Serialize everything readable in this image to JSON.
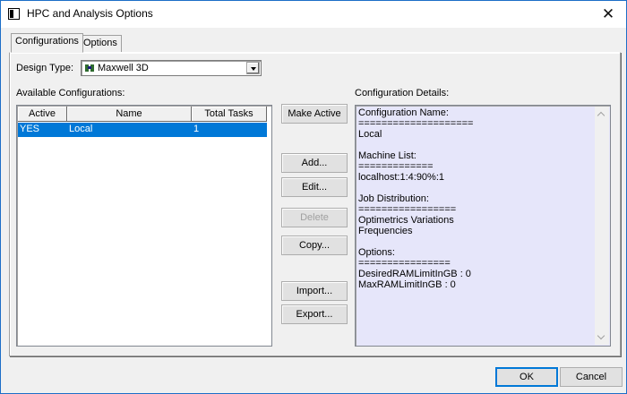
{
  "window": {
    "title": "HPC and Analysis Options",
    "close_glyph": "✕"
  },
  "tabs": [
    {
      "label": "Configurations",
      "active": true
    },
    {
      "label": "Options",
      "active": false
    }
  ],
  "design_type": {
    "label": "Design Type:",
    "value": "Maxwell 3D",
    "icon": "maxwell-icon"
  },
  "available": {
    "label": "Available Configurations:",
    "columns": [
      "Active",
      "Name",
      "Total Tasks"
    ],
    "rows": [
      {
        "active": "YES",
        "name": "Local",
        "tasks": "1",
        "selected": true
      }
    ]
  },
  "buttons": {
    "make_active": "Make Active",
    "add": "Add...",
    "edit": "Edit...",
    "delete": "Delete",
    "copy": "Copy...",
    "import": "Import...",
    "export": "Export..."
  },
  "details": {
    "label": "Configuration Details:",
    "text": "Configuration Name:\n====================\nLocal\n\nMachine List:\n=============\nlocalhost:1:4:90%:1\n\nJob Distribution:\n=================\nOptimetrics Variations\nFrequencies\n\nOptions:\n================\nDesiredRAMLimitInGB : 0\nMaxRAMLimitInGB : 0"
  },
  "footer": {
    "ok": "OK",
    "cancel": "Cancel"
  },
  "colors": {
    "selection": "#0078d7",
    "details_bg": "#e6e6fa",
    "border_accent": "#1c6ec7"
  }
}
